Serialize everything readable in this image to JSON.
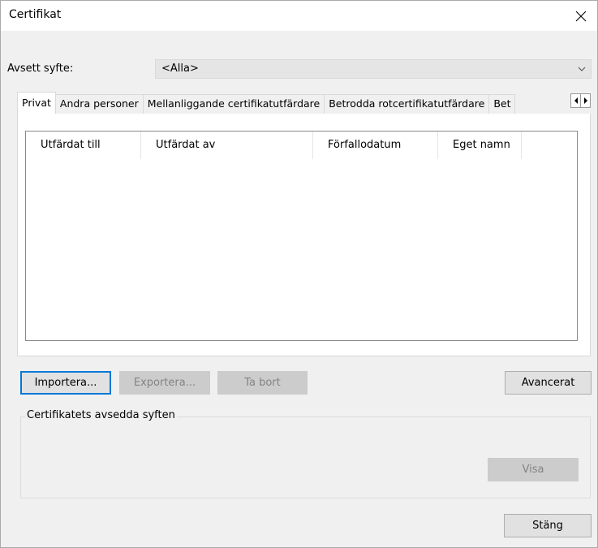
{
  "window": {
    "title": "Certifikat",
    "close_icon": "close-icon"
  },
  "purpose": {
    "label": "Avsett syfte:",
    "selected": "<Alla>"
  },
  "tabs": [
    {
      "label": "Privat",
      "active": true
    },
    {
      "label": "Andra personer"
    },
    {
      "label": "Mellanliggande certifikatutfärdare"
    },
    {
      "label": "Betrodda rotcertifikatutfärdare"
    },
    {
      "label": "Bet"
    }
  ],
  "list": {
    "columns": [
      "Utfärdat till",
      "Utfärdat av",
      "Förfallodatum",
      "Eget namn"
    ],
    "rows": []
  },
  "buttons": {
    "import": "Importera...",
    "export": "Exportera...",
    "remove": "Ta bort",
    "advanced": "Avancerat",
    "view": "Visa",
    "close": "Stäng"
  },
  "purposes_group": {
    "label": "Certifikatets avsedda syften"
  }
}
